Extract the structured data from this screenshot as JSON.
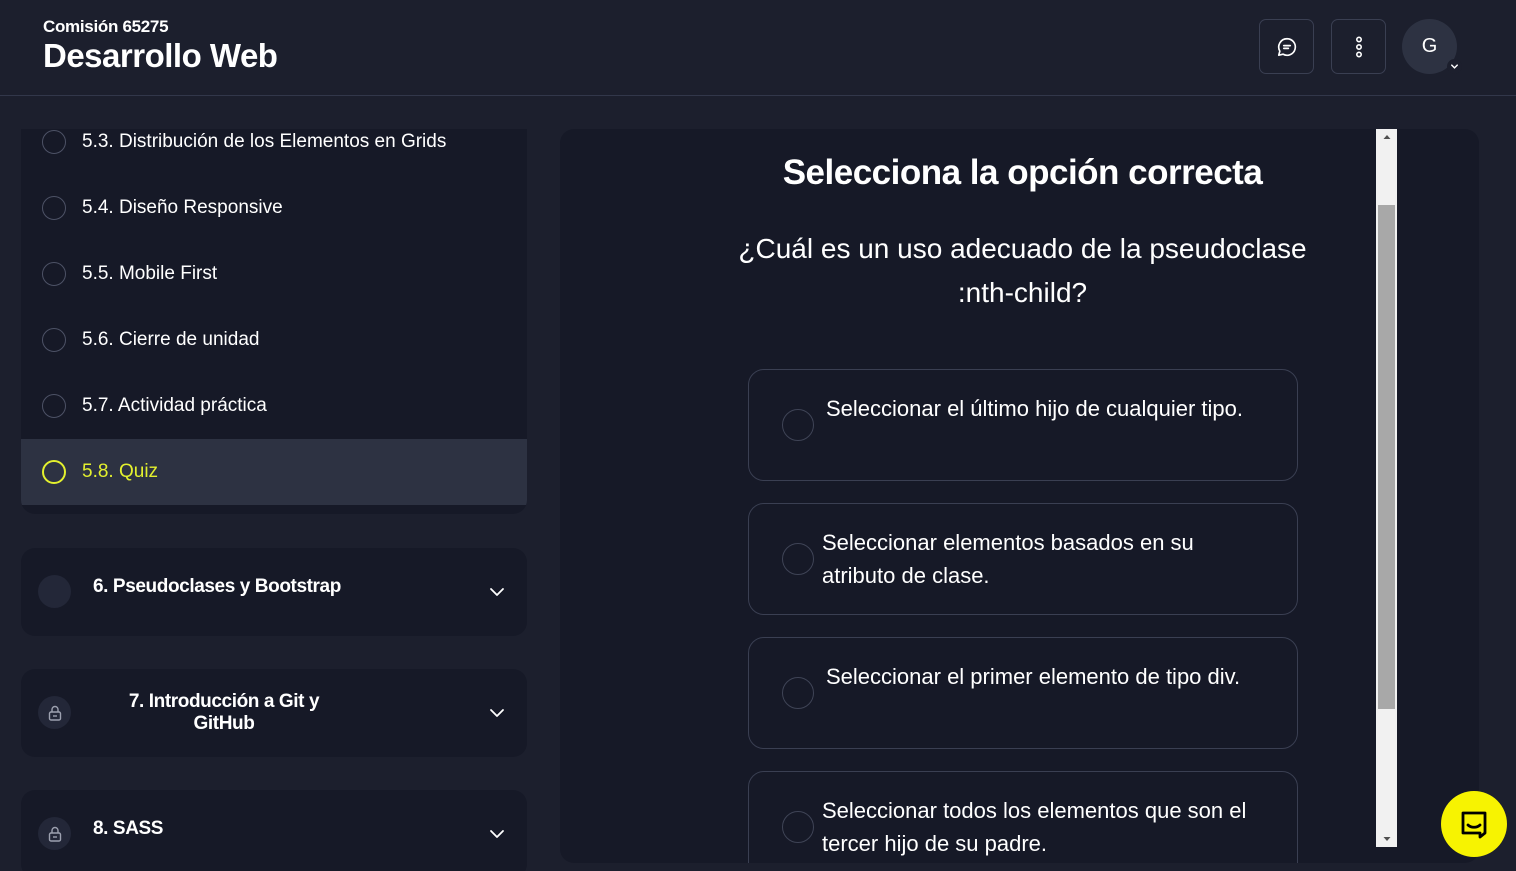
{
  "header": {
    "subtitle": "Comisión 65275",
    "title": "Desarrollo Web",
    "avatar_initial": "G"
  },
  "sidebar": {
    "lessons": [
      {
        "label": "5.3. Distribución de los Elementos en Grids"
      },
      {
        "label": "5.4. Diseño Responsive"
      },
      {
        "label": "5.5. Mobile First"
      },
      {
        "label": "5.6. Cierre de unidad"
      },
      {
        "label": "5.7. Actividad práctica"
      },
      {
        "label": "5.8. Quiz",
        "active": true
      }
    ],
    "modules": [
      {
        "title": "6. Pseudoclases y Bootstrap",
        "icon": "circle-icon",
        "locked": false
      },
      {
        "title": "7. Introducción a Git y GitHub",
        "icon": "lock-icon",
        "locked": true
      },
      {
        "title": "8. SASS",
        "icon": "lock-icon",
        "locked": true
      }
    ]
  },
  "quiz": {
    "heading": "Selecciona la opción correcta",
    "question": "¿Cuál es un uso adecuado de la pseudoclase :nth-child?",
    "options": [
      {
        "text": "Seleccionar el último hijo de cualquier tipo."
      },
      {
        "text": "Seleccionar elementos basados en su atributo de clase."
      },
      {
        "text": "Seleccionar el primer elemento de tipo div."
      },
      {
        "text": "Seleccionar todos los elementos que son el tercer hijo de su padre."
      }
    ]
  },
  "colors": {
    "background": "#1c1f2d",
    "card": "#161927",
    "active_row": "#2d3242",
    "accent_yellow": "#e3f02e",
    "help_button": "#f7f301"
  },
  "icons": {
    "chat": "chat-bubble-icon",
    "more": "vertical-dots-icon",
    "avatar_chevron": "chevron-down-icon",
    "module_chevron": "chevron-down-icon",
    "help": "chat-support-icon"
  }
}
